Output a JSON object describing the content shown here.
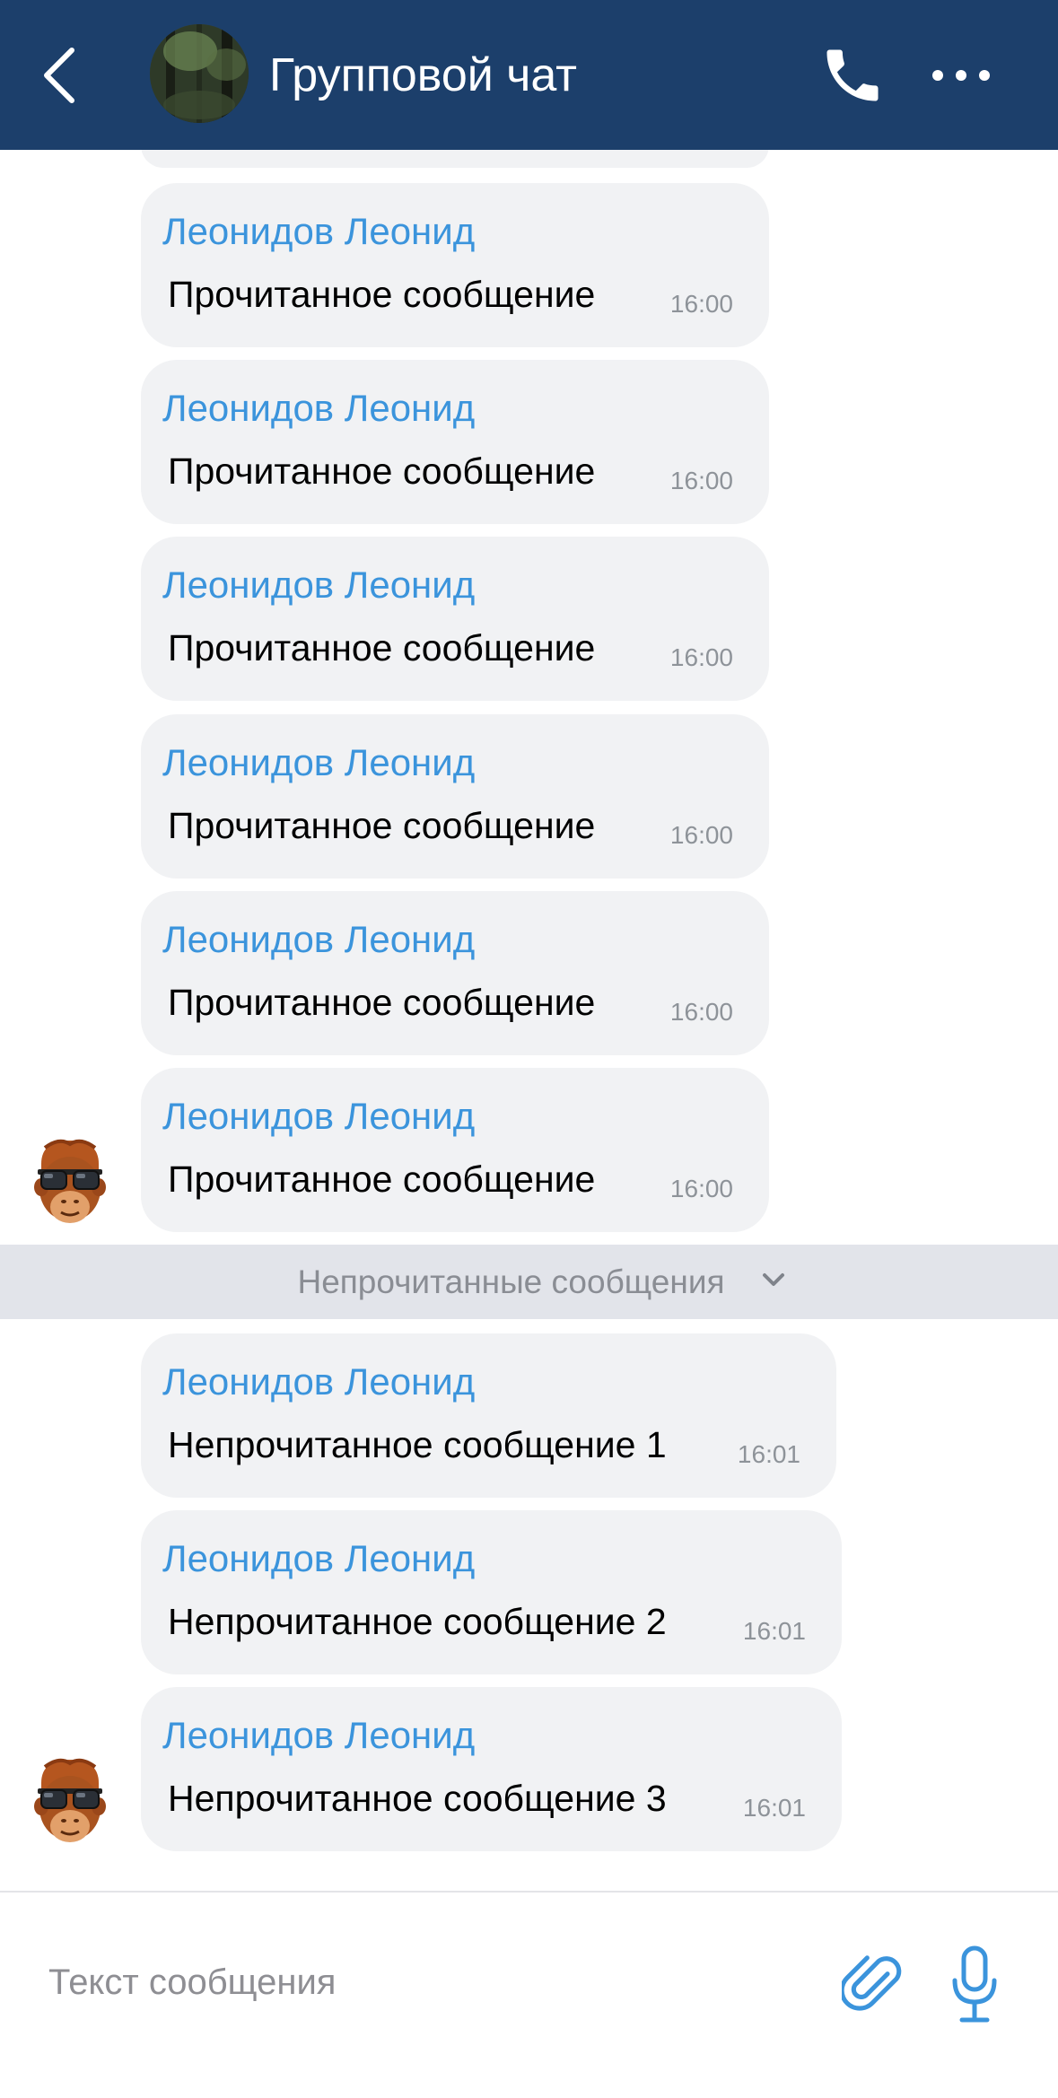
{
  "header": {
    "title": "Групповой чат",
    "back_icon": "chevron-left-icon",
    "call_icon": "phone-icon",
    "more_icon": "more-horizontal-icon",
    "background": "#1c3f6b"
  },
  "messages_read": [
    {
      "sender": "Леонидов Леонид",
      "text": "Прочитанное сообщение",
      "time": "16:00"
    },
    {
      "sender": "Леонидов Леонид",
      "text": "Прочитанное сообщение",
      "time": "16:00"
    },
    {
      "sender": "Леонидов Леонид",
      "text": "Прочитанное сообщение",
      "time": "16:00"
    },
    {
      "sender": "Леонидов Леонид",
      "text": "Прочитанное сообщение",
      "time": "16:00"
    },
    {
      "sender": "Леонидов Леонид",
      "text": "Прочитанное сообщение",
      "time": "16:00"
    },
    {
      "sender": "Леонидов Леонид",
      "text": "Прочитанное сообщение",
      "time": "16:00"
    }
  ],
  "unread_divider": {
    "label": "Непрочитанные сообщения",
    "icon": "chevron-down-icon"
  },
  "messages_unread": [
    {
      "sender": "Леонидов Леонид",
      "text": "Непрочитанное сообщение 1",
      "time": "16:01"
    },
    {
      "sender": "Леонидов Леонид",
      "text": "Непрочитанное сообщение 2",
      "time": "16:01"
    },
    {
      "sender": "Леонидов Леонид",
      "text": "Непрочитанное сообщение 3",
      "time": "16:01"
    }
  ],
  "composer": {
    "placeholder": "Текст сообщения",
    "attach_icon": "paperclip-icon",
    "mic_icon": "microphone-icon"
  },
  "colors": {
    "accent": "#3b94dc",
    "bubble": "#f1f2f4",
    "divider": "#e2e4ea"
  }
}
